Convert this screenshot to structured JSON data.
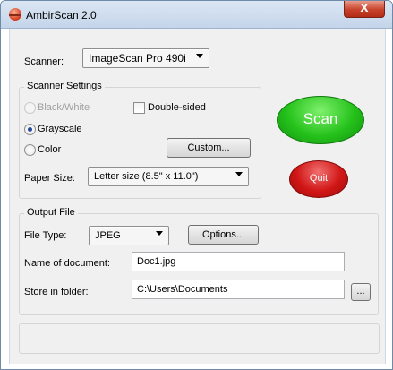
{
  "window": {
    "title": "AmbirScan 2.0",
    "close_glyph": "X"
  },
  "scanner": {
    "label": "Scanner:",
    "selected": "ImageScan Pro 490i"
  },
  "scanner_settings": {
    "title": "Scanner Settings",
    "color_modes": [
      {
        "label": "Black/White",
        "selected": false,
        "enabled": false
      },
      {
        "label": "Grayscale",
        "selected": true,
        "enabled": true
      },
      {
        "label": "Color",
        "selected": false,
        "enabled": true
      }
    ],
    "double_sided_label": "Double-sided",
    "double_sided_checked": false,
    "custom_button": "Custom...",
    "paper_size_label": "Paper Size:",
    "paper_size_selected": "Letter size (8.5\" x 11.0\")"
  },
  "actions": {
    "scan_label": "Scan",
    "quit_label": "Quit"
  },
  "output_file": {
    "title": "Output File",
    "file_type_label": "File Type:",
    "file_type_selected": "JPEG",
    "options_button": "Options...",
    "name_label": "Name of document:",
    "name_value": "Doc1.jpg",
    "folder_label": "Store in folder:",
    "folder_value": "C:\\Users\\Documents",
    "browse_button": "..."
  },
  "status_bar": {
    "text": ""
  }
}
